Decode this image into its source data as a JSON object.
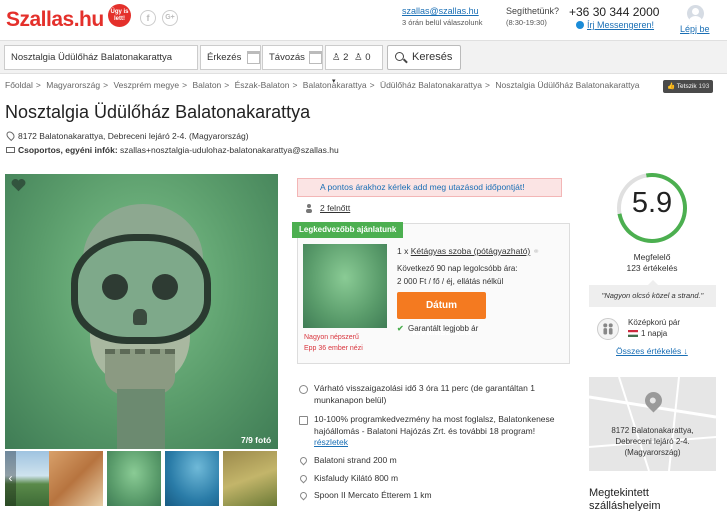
{
  "header": {
    "logo": "Szallas.hu",
    "logo_badge": "Úgy is lett!",
    "social_fb": "f",
    "social_gplus": "G+",
    "email": "szallas@szallas.hu",
    "email_sub": "3 órán belül válaszolunk",
    "help_question": "Segíthetünk?",
    "help_hours": "(8:30-19:30)",
    "phone": "+36 30 344 2000",
    "messenger": "Írj Messengeren!",
    "login": "Lépj be"
  },
  "search": {
    "destination": "Nosztalgia Üdülőház Balatonakarattya",
    "checkin_placeholder": "Érkezés",
    "checkout_placeholder": "Távozás",
    "guests_adults": "2",
    "guests_children": "0",
    "button": "Keresés"
  },
  "breadcrumb": {
    "items": [
      "Főoldal",
      "Magyarország",
      "Veszprém megye",
      "Balaton",
      "Észak-Balaton",
      "Balatonakarattya",
      "Üdülőház Balatonakarattya",
      "Nosztalgia Üdülőház Balatonakarattya"
    ],
    "separator": ">"
  },
  "share": {
    "label": "Tetszik",
    "count": "193"
  },
  "property": {
    "title": "Nosztalgia Üdülőház Balatonakarattya",
    "address": "8172 Balatonakarattya, Debreceni lejáró 2-4. (Magyarország)",
    "groups_label": "Csoportos, egyéni infók:",
    "groups_email": "szallas+nosztalgia-udulohaz-balatonakarattya@szallas.hu"
  },
  "gallery": {
    "counter": "7/9 fotó",
    "prev": "‹"
  },
  "booking": {
    "warning": "A pontos árakhoz kérlek add meg utazásod időpontját!",
    "guests": "2 felnőtt",
    "ribbon": "Legkedvezőbb ajánlatunk",
    "room_qty": "1 x",
    "room_name": "Kétágyas szoba (pótágyazható)",
    "price_line1": "Következő 90 nap legolcsóbb ára:",
    "price_line2": "2 000 Ft / fő / éj, ellátás nélkül",
    "date_button": "Dátum kiválasztása",
    "best_price": "Garantált legjobb ár",
    "popular1": "Nagyon népszerű",
    "popular2": "Epp 36 ember nézi"
  },
  "info": {
    "response": "Várható visszaigazolási idő 3 óra 11 perc (de garantáltan 1 munkanapon belül)",
    "discount": "10-100% programkedvezmény ha most foglalsz, Balatonkenese hajóállomás - Balatoni Hajózás Zrt. és további 18 program!",
    "discount_link": "részletek",
    "poi1": "Balatoni strand 200 m",
    "poi2": "Kisfaludy Kilátó 800 m",
    "poi3": "Spoon II Mercato Étterem 1 km"
  },
  "rating": {
    "score": "5.9",
    "word": "Megfelelő",
    "count": "123 értékelés",
    "quote": "\"Nagyon olcsó közel a strand.\"",
    "reviewer_type": "Középkorú pár",
    "reviewer_nights": "1 napja",
    "all_reviews": "Összes értékelés ↓"
  },
  "map": {
    "address_line1": "8172 Balatonakarattya,",
    "address_line2": "Debreceni lejáró 2-4.",
    "address_line3": "(Magyarország)"
  },
  "seen": {
    "title_line1": "Megtekintett",
    "title_line2": "szálláshelyeim"
  },
  "colors": {
    "brand": "#e4302b",
    "accent": "#f47a20",
    "link": "#1a6fb5",
    "success": "#4caf50"
  }
}
